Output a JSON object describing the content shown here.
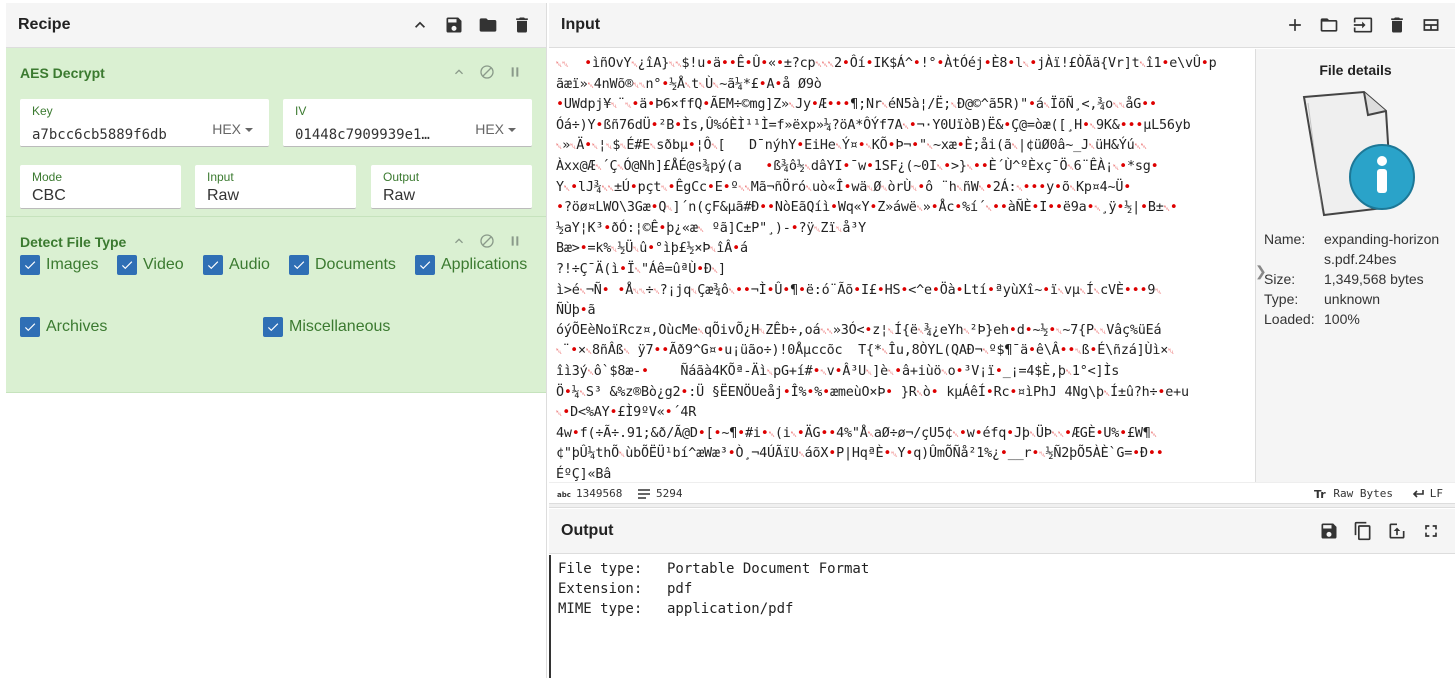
{
  "recipe": {
    "title": "Recipe",
    "operations": [
      {
        "name": "AES Decrypt",
        "key": {
          "label": "Key",
          "value": "a7bcc6cb5889f6db",
          "format": "HEX"
        },
        "iv": {
          "label": "IV",
          "value": "01448c7909939e1…",
          "format": "HEX"
        },
        "mode": {
          "label": "Mode",
          "value": "CBC"
        },
        "input": {
          "label": "Input",
          "value": "Raw"
        },
        "output": {
          "label": "Output",
          "value": "Raw"
        }
      },
      {
        "name": "Detect File Type",
        "checkboxes": [
          "Images",
          "Video",
          "Audio",
          "Documents",
          "Applications",
          "Archives",
          "Miscellaneous"
        ]
      }
    ]
  },
  "input": {
    "title": "Input",
    "lines": [
      "␀␀  ◆ìñOvY␀¿îA}␀␀$!u◆ä◆◆Ê◆Û◆«◆±?cp␀␀␀2◆Ôí◆IK$Á^◆!°◆ÀtÓéj◆È8◆l␀◆jÀï!£ÒÃä{Vr]t␀î1◆e\\vÛ◆p",
      "ãæï»␀4nWõ®␀␀n°◆½Å␀t␀Ù␀~ã¼*£◆A◆å Ø9ò",
      "◆UWdpj¥␀¨␀◆ä◆Þ6×ffQ◆ÃEM÷©mg]Z»␀Jy◆Æ◆◆◆¶;Nr␀éN5à¦/Ë;␀Ð@©^ã5R)\"◆á␀ÏõÑ¸<,¾o␀␀åG◆◆",
      "Óá÷)Y◆ßñ76dÜ◆²B◆Ìs,Û%óÈÌ¹¹Ì=f»ëxp»¼?öA*ÔÝf7A␀◆¬·Y0UïòB)Ë&◆Ç@=òæ([¸H◆␀9K&◆◆◆µL56yb",
      "␀»␀Ä◆␀¦␀$␀É#E␀sðbµ◆¦Ô␀[   D¯nýhY◆EiHe␀Ý¤◆␀KÕ◆Þ¬◆\"␀~xæ◆È;åi(ã␀|¢üØ0â~_J␀üH&Ýú␀␀",
      "Àxx@Æ␀´Ç␀Ó@Nh]£ÅÉ@s¾pý(a   ◆ß¾ô½␀dâYI◆¯w◆1SF¿(~0I␀◆>}␀◆◆È´Ù^ºÈxç¯Ö␀6¨ÊÀ¡␀◆*sg◆",
      "Y␀◆lJ¾␀␀±Ú◆pçt␀◆ÊgCc◆E◆º␀␀Mã¬ñÖró␀uò«Î◆wä␀Ø␀òrÙ␀◆ô ¨h␀ñW␀◆2Á:␀◆◆◆y◆õ␀Kp¤4~Ü◆",
      "◆?öø¤LWO\\3Gæ◆Q␀]´n(çF&µã#Ð◆◆NòEãQíì◆Wq«Y◆Z»áwë␀»◆Åc◆%í´␀◆◆àÑÈ◆I◆◆ë9a◆␀¸ÿ◆½|◆B±␀◆",
      "½aY¦K³◆ðÓ:¦©Ê◆þ¿«æ␀ ºã]C±P\"¸)-◆?ÿ␀Zï␀å³Y",
      "Bæ>◆=k%␀½Ü␀û◆°ìþ£½×Þ␀îÂ◆á",
      "?!÷Ç¯Ä(ì◆Ï␀\"Áê=ûªÙ◆Ð␀]",
      "ì>é␀¬Ñ◆ ◆Å␀␀÷␀?¡jq␀Çæ¾ô␀◆◆¬Ì◆Û◆¶◆ë:ó¨Ãõ◆I£◆HS◆<^e◆Öà◆Ltí◆ªyùXî~◆ï␀vµ␀Í␀cVÈ◆◆◆9␀",
      "ÑÙþ◆ã",
      "óýÕEèNoïRcz¤,OùcMe␀qÕivÕ¿H␀ZÊb÷,oá␀␀»3Ó<◆z¦␀Í{ë␀¾¿eYh␀²Þ}eh◆d◆~½◆␀~7{P␀␀Vâç%üEá",
      "␀¨◆×␀8ñÂß␀ ÿ7◆◆Ãð9^G¤◆u¡üão÷)!0Åµccõc  T{*␀Îu,8ÒYL(QAÐ¬␀º$¶¯ä◆ê\\Â◆◆␀ß◆É\\ñzá]Ùì×␀",
      "îì3ý␀ô`$8æ-◆    Ñáãà4KÕª-Äì␀pG+í#◆␀v◆Â³U␀]è␀◆â+iùö␀o◆³V¡ï◆_¡=4$È,þ␀1°<]Ìs",
      "Ö◆¼␀S³ &%z®Bò¿g2◆:Ü §ËENÖUeåj◆Î%◆%◆æmeùO×Þ◆ }R␀ò◆ kµÁêÍ◆Rc◆¤ìPhJ 4Ng\\þ␀Í±û?h÷◆e+u",
      "␀◆D<%AY◆£Ì9ºV«◆´4R",
      "4w◆f(÷Ã÷.91;&ð/Ã@D◆[◆~¶◆#i◆␀(i␀◆ÄG◆◆4%\"Å␀aØ÷ø¬/çU5¢␀◆w◆éfq◆Jþ␀ÜÞ␀␀◆ÆGÈ◆U%◆£W¶␀",
      "¢\"þÛ¼thÕ␀ùbÕËÜ¹bí^æWæ³◆Ò¸¬4ÚÃïU␀áõX◆P|HqªÈ◆␀Y◆q)ÛmÕÑå²1%¿◆__r◆␀½Ñ2þÕ5ÀÈ`G=◆Ð◆◆",
      "ÉºÇ]«Bâ"
    ],
    "status": {
      "length": "1349568",
      "lines": "5294",
      "encoding": "Raw Bytes",
      "eol": "LF"
    },
    "file_details": {
      "title": "File details",
      "name_label": "Name:",
      "name": "expanding-horizons.pdf.24bes",
      "size_label": "Size:",
      "size": "1,349,568 bytes",
      "type_label": "Type:",
      "type": "unknown",
      "loaded_label": "Loaded:",
      "loaded": "100%"
    }
  },
  "output": {
    "title": "Output",
    "rows": [
      {
        "key": "File type:",
        "value": "Portable Document Format"
      },
      {
        "key": "Extension:",
        "value": "pdf"
      },
      {
        "key": "MIME type:",
        "value": "application/pdf"
      }
    ]
  },
  "colors": {
    "operation_bg": "#daf0d2",
    "operation_text": "#3b7a30",
    "checkbox": "#2f6fb5",
    "special_char": "#dd0000"
  }
}
